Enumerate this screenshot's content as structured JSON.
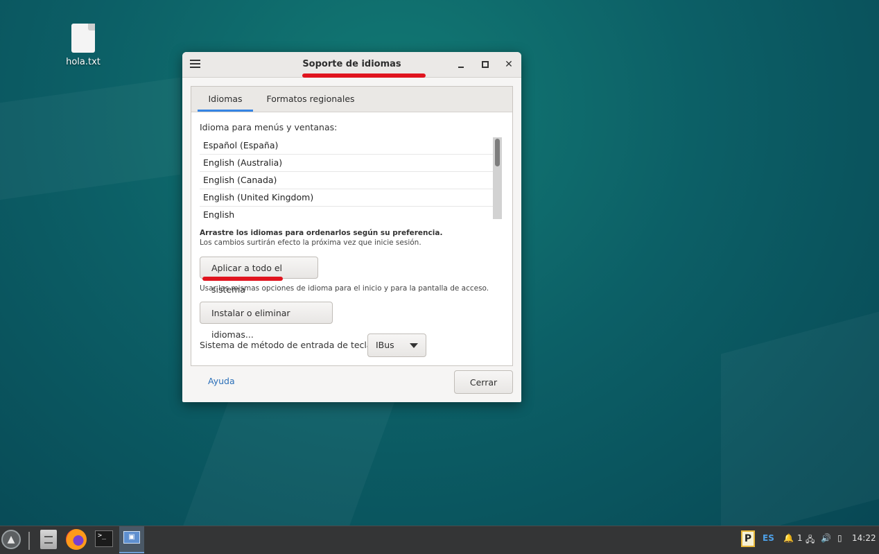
{
  "desktop": {
    "icons": [
      {
        "label": "hola.txt",
        "icon": "text-file-icon"
      }
    ]
  },
  "window": {
    "title": "Soporte de idiomas",
    "menu_icon": "hamburger-menu-icon",
    "controls": {
      "minimize_icon": "minimize-icon",
      "maximize_icon": "maximize-icon",
      "close_label": "✕"
    },
    "tabs": [
      {
        "label": "Idiomas",
        "active": true
      },
      {
        "label": "Formatos regionales",
        "active": false
      }
    ],
    "language_section": {
      "label": "Idioma para menús y ventanas:",
      "languages": [
        "Español (España)",
        "English (Australia)",
        "English (Canada)",
        "English (United Kingdom)",
        "English"
      ],
      "hint_bold": "Arrastre los idiomas para ordenarlos según su preferencia.",
      "hint": "Los cambios surtirán efecto la próxima vez que inicie sesión."
    },
    "apply_button": "Aplicar a todo el sistema",
    "apply_hint": "Usar las mismas opciones de idioma para el inicio y para la pantalla de acceso.",
    "install_button": "Instalar o eliminar idiomas...",
    "input_method": {
      "label": "Sistema de método de entrada de teclado:",
      "selected": "IBus"
    },
    "help_link": "Ayuda",
    "close_button": "Cerrar"
  },
  "taskbar": {
    "apps": [
      {
        "name": "start-menu",
        "icon": "start-menu-icon"
      },
      {
        "name": "file-manager",
        "icon": "file-cabinet-icon"
      },
      {
        "name": "firefox",
        "icon": "firefox-icon"
      },
      {
        "name": "terminal",
        "icon": "terminal-icon",
        "glyph": ">_"
      },
      {
        "name": "language-support",
        "icon": "language-support-icon",
        "active": true
      }
    ],
    "tray": {
      "clipboard_label": "P",
      "keyboard_layout": "ES",
      "notifications_count": "1",
      "clock": "14:22"
    }
  },
  "colors": {
    "accent": "#3584e4",
    "annotation_red": "#e0141e",
    "link": "#2a6fb8",
    "layout_indicator": "#4ea1e8"
  }
}
